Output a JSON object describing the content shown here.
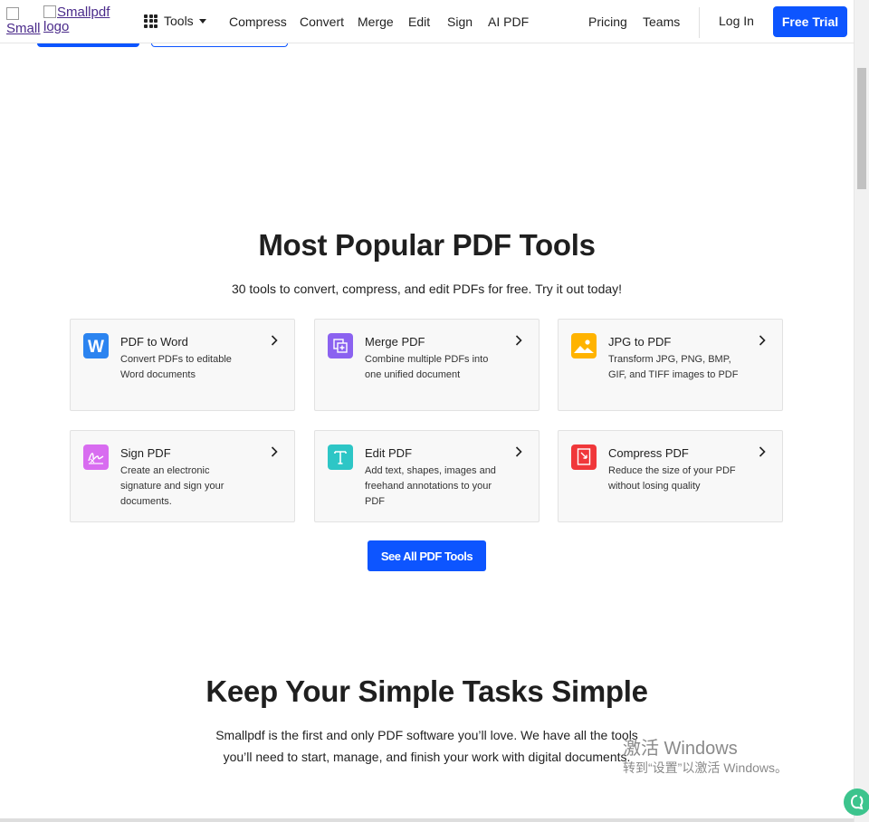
{
  "header": {
    "logo_alt_1": "Small logo",
    "logo_alt_2": "Smallpdf logo",
    "tools_label": "Tools",
    "nav": [
      "Compress",
      "Convert",
      "Merge",
      "Edit",
      "Sign",
      "AI PDF"
    ],
    "pricing": "Pricing",
    "teams": "Teams",
    "login": "Log In",
    "free_trial": "Free Trial"
  },
  "popular": {
    "title": "Most Popular PDF Tools",
    "subtitle": "30 tools to convert, compress, and edit PDFs for free. Try it out today!",
    "cards": [
      {
        "title": "PDF to Word",
        "desc": "Convert PDFs to editable Word documents",
        "icon": "word-icon",
        "color": "#2b84f0"
      },
      {
        "title": "Merge PDF",
        "desc": "Combine multiple PDFs into one unified document",
        "icon": "merge-icon",
        "color": "#8b62f0"
      },
      {
        "title": "JPG to PDF",
        "desc": "Transform JPG, PNG, BMP, GIF, and TIFF images to PDF",
        "icon": "image-icon",
        "color": "#ffb300"
      },
      {
        "title": "Sign PDF",
        "desc": "Create an electronic signature and sign your documents.",
        "icon": "signature-icon",
        "color": "#d86cf0"
      },
      {
        "title": "Edit PDF",
        "desc": "Add text, shapes, images and freehand annotations to your PDF",
        "icon": "text-icon",
        "color": "#2dc6c6"
      },
      {
        "title": "Compress PDF",
        "desc": "Reduce the size of your PDF without losing quality",
        "icon": "compress-icon",
        "color": "#f0373a"
      }
    ],
    "see_all": "See All PDF Tools"
  },
  "simple": {
    "title": "Keep Your Simple Tasks Simple",
    "line1": "Smallpdf is the first and only PDF software you’ll love. We have all the tools",
    "line2": "you’ll need to start, manage, and finish your work with digital documents."
  },
  "watermark": {
    "line1": "激活 Windows",
    "line2": "转到“设置”以激活 Windows。"
  },
  "accent": "#0d55ff"
}
